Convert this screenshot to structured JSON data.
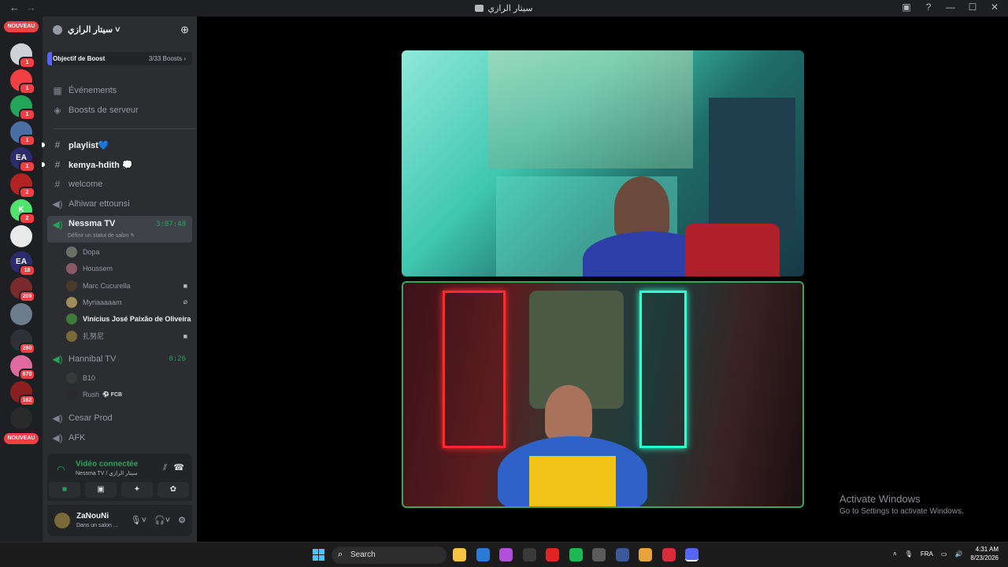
{
  "window": {
    "title": "سيتار الرازي",
    "nav_back": "←",
    "nav_forward": "→",
    "controls": [
      "▣",
      "?",
      "—",
      "☐",
      "✕"
    ]
  },
  "guilds": {
    "new_label": "NOUVEAU",
    "items": [
      {
        "badge": "1",
        "color": "#cfd2d6"
      },
      {
        "badge": "1",
        "color": "#f23f43"
      },
      {
        "badge": "1",
        "color": "#23a55a"
      },
      {
        "badge": "1",
        "color": "#4a6fa5"
      },
      {
        "badge": "1",
        "color": "#2b2b6e",
        "text": "EA"
      },
      {
        "badge": "2",
        "color": "#b32222"
      },
      {
        "badge": "2",
        "color": "#52e26e",
        "text": "K"
      },
      {
        "badge": "",
        "color": "#e9e9e9"
      },
      {
        "badge": "18",
        "color": "#2b2b6e",
        "text": "EA"
      },
      {
        "badge": "209",
        "color": "#7a2a2a"
      },
      {
        "badge": "",
        "color": "#6b7d8c"
      },
      {
        "badge": "280",
        "color": "#2f3136"
      },
      {
        "badge": "670",
        "color": "#e06aa0"
      },
      {
        "badge": "162",
        "color": "#8b1e1e"
      },
      {
        "badge": "",
        "color": "#2a2a2a"
      }
    ]
  },
  "server": {
    "name": "سيتار الرازي",
    "invite_icon": "add-member-icon",
    "boost_label": "Objectif de Boost",
    "boost_count": "3/33 Boosts",
    "boost_progress": 0.09
  },
  "menu": {
    "events": "Événements",
    "boosts": "Boosts de serveur"
  },
  "channels": [
    {
      "kind": "text",
      "name": "playlist💙",
      "unread": true
    },
    {
      "kind": "text",
      "name": "kemya-hdith 💭",
      "unread": true
    },
    {
      "kind": "text",
      "name": "welcome",
      "unread": false
    },
    {
      "kind": "voice",
      "name": "Alhiwar ettounsi"
    }
  ],
  "active_channel": {
    "name": "Nessma TV",
    "timer": "3:07:48",
    "status_hint": "Définir un statut de salon"
  },
  "nessma_members": [
    {
      "name": "Dopa",
      "color": "#6a6f66",
      "state": ""
    },
    {
      "name": "Houssem",
      "color": "#8b5a66",
      "state": ""
    },
    {
      "name": "Marc Cucurella",
      "color": "#4a3a2a",
      "state": "■"
    },
    {
      "name": "Myriaaaaam",
      "color": "#a08c5a",
      "state": "⌀"
    },
    {
      "name": "Vinícius José Paixão de Oliveira",
      "color": "#3f7a3a",
      "state": ""
    },
    {
      "name": "扎努尼",
      "color": "#7a6a3a",
      "state": "■"
    }
  ],
  "channel2": {
    "name": "Hannibal TV",
    "timer": "0:26"
  },
  "hannibal_members": [
    {
      "name": "B10",
      "color": "#3a3a3a"
    },
    {
      "name": "Rush",
      "color": "#2a2a2a",
      "tag": "FCB"
    }
  ],
  "channels_after": [
    {
      "name": "Cesar Prod"
    },
    {
      "name": "AFK"
    }
  ],
  "voice": {
    "title": "Vidéo connectée",
    "location": "Nessma TV / سيتار الرازي",
    "buttons": [
      "■",
      "▣",
      "✦",
      "✿"
    ]
  },
  "user": {
    "name": "ZaNouNi",
    "status": "Dans un salon ..."
  },
  "watermark": {
    "title": "Activate Windows",
    "subtitle": "Go to Settings to activate Windows."
  },
  "taskbar": {
    "search_placeholder": "Search",
    "apps": [
      "#f6c342",
      "#2b7bd6",
      "#b04fd8",
      "#3a3a3a",
      "#e02424",
      "#1db954",
      "#5a5a5a",
      "#3b5998",
      "#e8a33d",
      "#d92b3a",
      "#5865f2"
    ],
    "lang": "FRA",
    "time": "4:31 AM",
    "date": "8/23/2026"
  }
}
